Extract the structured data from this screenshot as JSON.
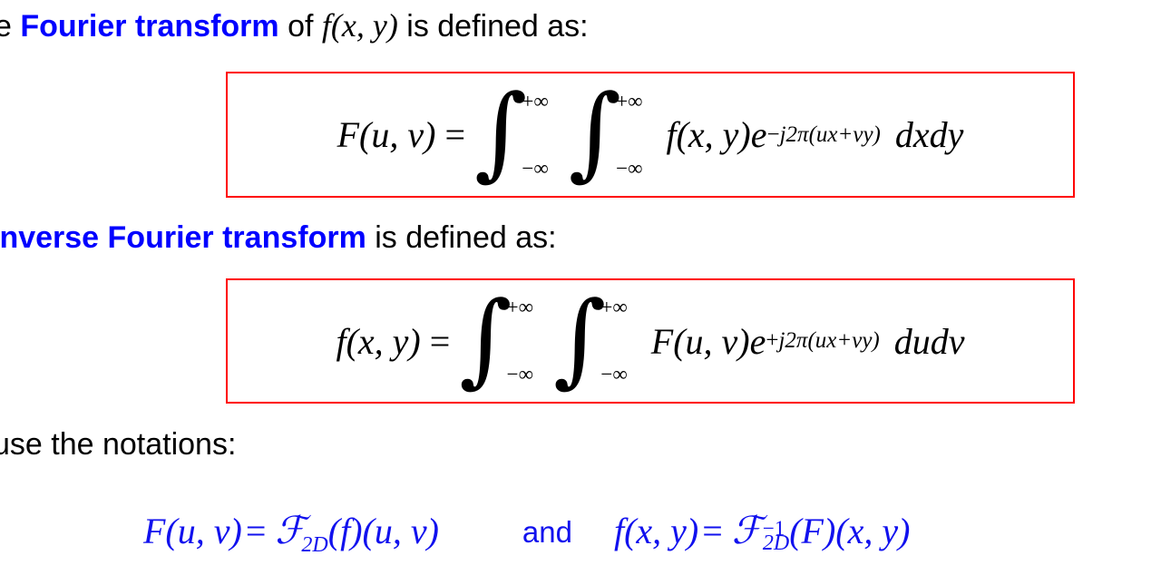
{
  "slide": {
    "background_color": "#FFFFFF",
    "accent_color": "#0000FF",
    "box_border_color": "#FF0000",
    "notation_color": "#1111EE"
  },
  "lines": {
    "intro": {
      "prefix_clipped": "e ",
      "emphasis": "Fourier transform",
      "middle": " of ",
      "math": "f(x, y)",
      "suffix": " is defined as:"
    },
    "inverse": {
      "emphasis": "inverse Fourier transform",
      "suffix": " is defined as:"
    },
    "notations": {
      "text": "use the notations:"
    }
  },
  "formulas": {
    "forward": {
      "lhs": "F(u, v)",
      "equals": "=",
      "integral_upper": "+∞",
      "integral_lower": "−∞",
      "integrand": "f(x, y)e",
      "exponent_sign": "−",
      "exponent": "j2π(ux+vy)",
      "differential": "dxdy"
    },
    "inverse": {
      "lhs": "f(x, y)",
      "equals": "=",
      "integral_upper": "+∞",
      "integral_lower": "−∞",
      "integrand": "F(u, v)e",
      "exponent_sign": "+",
      "exponent": "j2π(ux+vy)",
      "differential": "dudv"
    }
  },
  "notation": {
    "left": {
      "lhs": "F(u, v)",
      "equals": "=",
      "operator": "ℱ",
      "subscript": "2D",
      "args": "(f)(u, v)"
    },
    "conjunction": "and",
    "right": {
      "lhs": "f(x, y)",
      "equals": "=",
      "operator": "ℱ",
      "superscript": "−1",
      "subscript": "2D",
      "args": "(F)(x, y)"
    }
  },
  "symbols": {
    "integral_sign": "∫"
  }
}
